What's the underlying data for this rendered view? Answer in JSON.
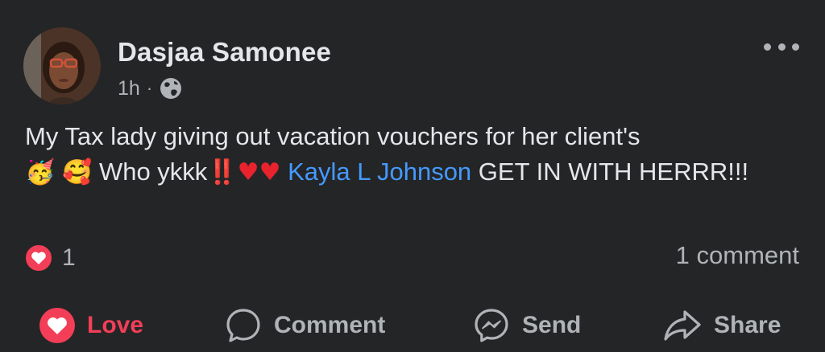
{
  "post": {
    "author_name": "Dasjaa Samonee",
    "timestamp": "1h",
    "separator": "·",
    "audience_icon": "globe-icon",
    "more_icon": "more-options-icon",
    "text_part1": "My Tax lady giving out vacation vouchers for her client's",
    "emoji_party": "🥳",
    "emoji_hearts_face": "🥰",
    "text_part2": " Who ykkk",
    "emoji_exclaim": "‼️",
    "emoji_heart": "♥",
    "mention": "Kayla L Johnson",
    "text_part3": "  GET IN WITH HERRR!!!"
  },
  "reactions": {
    "icon": "love-reaction-icon",
    "count": "1",
    "comment_count": "1 comment"
  },
  "actions": {
    "love_label": "Love",
    "comment_label": "Comment",
    "send_label": "Send",
    "share_label": "Share"
  },
  "colors": {
    "background": "#242526",
    "text": "#e4e6eb",
    "secondary_text": "#b0b3b8",
    "mention": "#4599ff",
    "love": "#f33e58"
  }
}
